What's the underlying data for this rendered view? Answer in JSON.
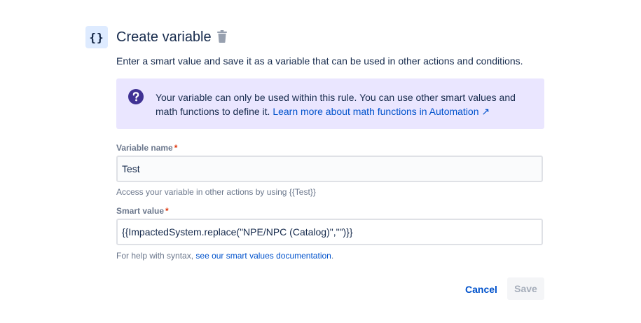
{
  "header": {
    "icon_text": "{}",
    "title": "Create variable",
    "subtitle": "Enter a smart value and save it as a variable that can be used in other actions and conditions."
  },
  "info": {
    "text": "Your variable can only be used within this rule. You can use other smart values and math functions to define it.",
    "link_label": "Learn more about math functions in Automation",
    "link_glyph": "↗"
  },
  "variable_name": {
    "label": "Variable name",
    "required_mark": "*",
    "value": "Test",
    "help": "Access your variable in other actions by using {{Test}}"
  },
  "smart_value": {
    "label": "Smart value",
    "required_mark": "*",
    "value": "{{ImpactedSystem.replace(\"NPE/NPC (Catalog)\",\"\")}}",
    "help_prefix": "For help with syntax,",
    "help_link": "see our smart values documentation",
    "help_suffix": "."
  },
  "actions": {
    "cancel_label": "Cancel",
    "save_label": "Save"
  },
  "colors": {
    "accent": "#0052cc",
    "info_bg": "#eae6ff",
    "info_icon": "#403294",
    "required": "#de350b"
  }
}
